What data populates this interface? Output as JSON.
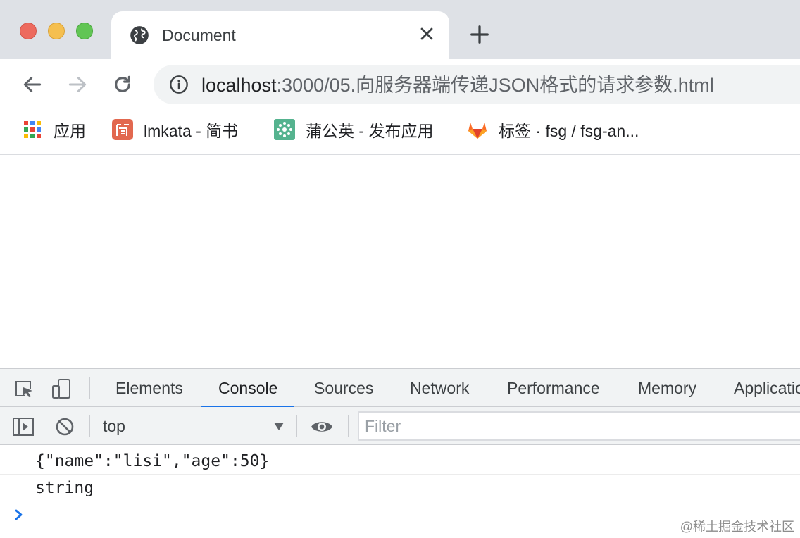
{
  "browser": {
    "tab": {
      "title": "Document",
      "favicon": "globe-icon"
    },
    "toolbar": {
      "url_host": "localhost",
      "url_path": ":3000/05.向服务器端传递JSON格式的请求参数.html"
    },
    "bookmarks": [
      {
        "label": "应用",
        "icon": "apps-grid-icon"
      },
      {
        "label": "lmkata - 简书",
        "icon": "jianshu-icon"
      },
      {
        "label": "蒲公英 - 发布应用",
        "icon": "pgyer-icon"
      },
      {
        "label": "标签 · fsg / fsg-an...",
        "icon": "gitlab-icon"
      }
    ]
  },
  "devtools": {
    "tabs": [
      {
        "label": "Elements"
      },
      {
        "label": "Console"
      },
      {
        "label": "Sources"
      },
      {
        "label": "Network"
      },
      {
        "label": "Performance"
      },
      {
        "label": "Memory"
      },
      {
        "label": "Applicatio"
      }
    ],
    "active_tab": "Console",
    "console_bar": {
      "context": "top",
      "filter_placeholder": "Filter"
    },
    "console_lines": [
      {
        "text": "{\"name\":\"lisi\",\"age\":50}"
      },
      {
        "text": "string"
      }
    ]
  },
  "watermark": "@稀土掘金技术社区",
  "colors": {
    "tabstrip": "#dee1e6",
    "accent": "#1a73e8",
    "close_red": "#ed6a5e",
    "minimize_yellow": "#f5bf4f",
    "zoom_green": "#61c554"
  }
}
